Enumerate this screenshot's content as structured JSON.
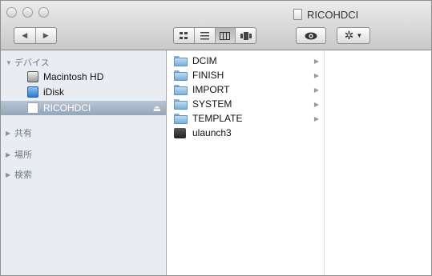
{
  "window": {
    "title": "RICOHDCI"
  },
  "toolbar": {
    "back_label": "◀",
    "forward_label": "▶",
    "view_icons": [
      "icon-view-icon",
      "list-view-icon",
      "column-view-icon",
      "coverflow-view-icon"
    ],
    "active_view": "column-view-icon",
    "quicklook_icon": "eye-icon",
    "action_icon": "gear-icon"
  },
  "sidebar": {
    "sections": [
      {
        "title": "デバイス",
        "expanded": true,
        "items": [
          {
            "label": "Macintosh HD",
            "icon": "hard-disk-icon",
            "selected": false
          },
          {
            "label": "iDisk",
            "icon": "idisk-icon",
            "selected": false
          },
          {
            "label": "RICOHDCI",
            "icon": "sd-card-icon",
            "selected": true,
            "eject": "⏏"
          }
        ]
      },
      {
        "title": "共有",
        "expanded": false
      },
      {
        "title": "場所",
        "expanded": false
      },
      {
        "title": "検索",
        "expanded": false
      }
    ]
  },
  "files": [
    {
      "name": "DCIM",
      "type": "folder"
    },
    {
      "name": "FINISH",
      "type": "folder"
    },
    {
      "name": "IMPORT",
      "type": "folder"
    },
    {
      "name": "SYSTEM",
      "type": "folder"
    },
    {
      "name": "TEMPLATE",
      "type": "folder"
    },
    {
      "name": "ulaunch3",
      "type": "executable"
    }
  ],
  "colors": {
    "selection": "#95a6ba",
    "sidebar_bg": "#e9edf2",
    "folder": "#7aaed8"
  }
}
